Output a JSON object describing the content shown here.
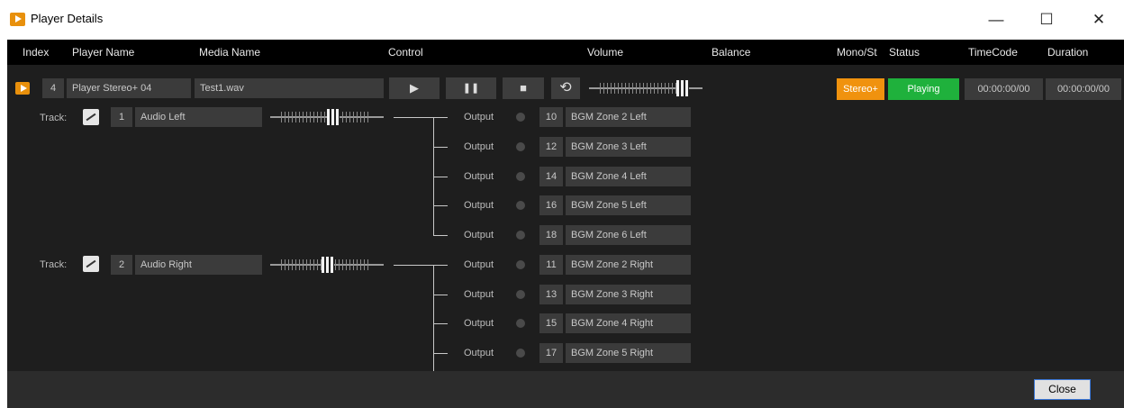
{
  "window": {
    "title": "Player Details",
    "minimize": "—",
    "maximize": "☐",
    "close": "✕"
  },
  "columns": [
    "Index",
    "Player Name",
    "Media Name",
    "Control",
    "Volume",
    "Balance",
    "Mono/St",
    "Status",
    "TimeCode",
    "Duration"
  ],
  "player": {
    "index": "4",
    "name": "Player Stereo+ 04",
    "media": "Test1.wav",
    "controls": {
      "play": "▶",
      "pause": "❚❚",
      "stop": "■",
      "loop": "⟲"
    },
    "volume_level": 0.85,
    "mono_st": "Stereo+",
    "status": "Playing",
    "timecode": "00:00:00/00",
    "duration": "00:00:00/00"
  },
  "tracks": [
    {
      "label": "Track:",
      "number": "1",
      "name": "Audio Left",
      "balance_level": 0.55,
      "outputs": [
        {
          "label": "Output",
          "num": "10",
          "zone": "BGM Zone 2 Left"
        },
        {
          "label": "Output",
          "num": "12",
          "zone": "BGM Zone 3 Left"
        },
        {
          "label": "Output",
          "num": "14",
          "zone": "BGM Zone 4 Left"
        },
        {
          "label": "Output",
          "num": "16",
          "zone": "BGM Zone 5 Left"
        },
        {
          "label": "Output",
          "num": "18",
          "zone": "BGM Zone 6 Left"
        }
      ]
    },
    {
      "label": "Track:",
      "number": "2",
      "name": "Audio Right",
      "balance_level": 0.5,
      "outputs": [
        {
          "label": "Output",
          "num": "11",
          "zone": "BGM Zone 2 Right"
        },
        {
          "label": "Output",
          "num": "13",
          "zone": "BGM Zone 3 Right"
        },
        {
          "label": "Output",
          "num": "15",
          "zone": "BGM Zone 4 Right"
        },
        {
          "label": "Output",
          "num": "17",
          "zone": "BGM Zone 5 Right"
        }
      ]
    }
  ],
  "footer": {
    "close_label": "Close"
  },
  "colors": {
    "stereo": "#f0920e",
    "playing": "#1fb13c",
    "accent": "#3c78d8"
  }
}
